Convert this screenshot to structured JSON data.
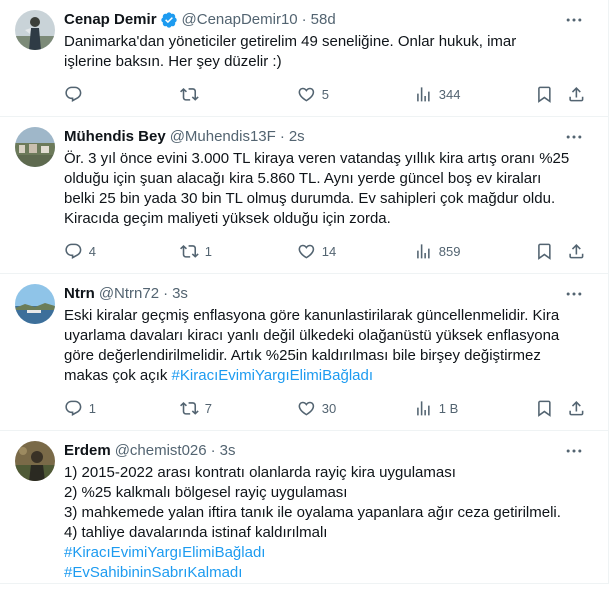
{
  "colors": {
    "accent": "#1d9bf0",
    "text": "#0f1419",
    "secondary": "#536471",
    "border": "#eff3f4"
  },
  "tweets": [
    {
      "name": "Cenap Demir",
      "verified": true,
      "handle": "@CenapDemir10",
      "time": "58d",
      "lines": [
        "Danimarka'dan yöneticiler getirelim 49 seneliğine. Onlar hukuk, imar",
        "işlerine baksın. Her şey düzelir :)"
      ],
      "hashtags": [],
      "replies": "",
      "retweets": "",
      "likes": "5",
      "views": "344"
    },
    {
      "name": "Mühendis Bey",
      "verified": false,
      "handle": "@Muhendis13F",
      "time": "2s",
      "lines": [
        "Ör. 3 yıl önce evini 3.000 TL kiraya veren vatandaş yıllık kira artış oranı %25",
        "olduğu için şuan alacağı kira 5.860 TL. Aynı yerde güncel boş ev kiraları",
        "belki 25 bin yada 30 bin TL olmuş durumda. Ev sahipleri çok mağdur oldu.",
        "Kiracıda geçim maliyeti yüksek olduğu için zorda."
      ],
      "hashtags": [],
      "replies": "4",
      "retweets": "1",
      "likes": "14",
      "views": "859"
    },
    {
      "name": "Ntrn",
      "verified": false,
      "handle": "@Ntrn72",
      "time": "3s",
      "lines": [
        "Eski kiralar geçmiş enflasyona göre kanunlastirilarak güncellenmelidir. Kira",
        "uyarlama davaları kiracı yanlı değil ülkedeki olağanüstü yüksek enflasyona",
        "göre değerlendirilmelidir. Artık %25in kaldırılması bile birşey değiştirmez",
        "makas çok açık"
      ],
      "hashtags": [
        "#KiracıEvimiYargıElimiBağladı"
      ],
      "replies": "1",
      "retweets": "7",
      "likes": "30",
      "views": "1 B"
    },
    {
      "name": "Erdem",
      "verified": false,
      "handle": "@chemist026",
      "time": "3s",
      "lines": [
        "1) 2015-2022 arası kontratı olanlarda rayiç kira uygulaması",
        "2) %25 kalkmalı bölgesel rayiç uygulaması",
        "3) mahkemede yalan iftira tanık ile oyalama yapanlara ağır ceza getirilmeli.",
        "4) tahliye davalarında istinaf kaldırılmalı"
      ],
      "hashtags": [
        "#KiracıEvimiYargıElimiBağladı",
        "#EvSahibininSabrıKalmadı"
      ],
      "replies": "",
      "retweets": "",
      "likes": "",
      "views": ""
    }
  ]
}
